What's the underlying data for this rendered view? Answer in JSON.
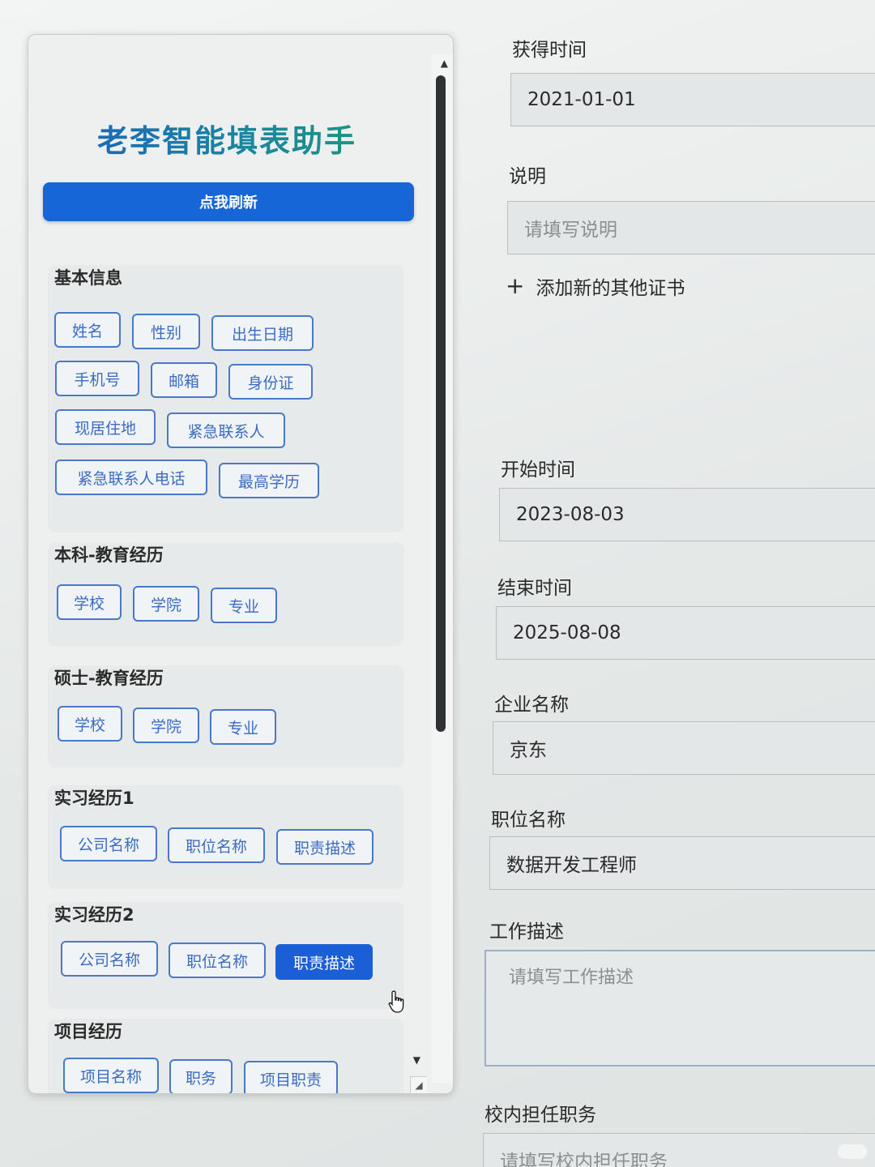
{
  "panel": {
    "title": "老李智能填表助手",
    "refresh_label": "点我刷新",
    "sections": {
      "basic": {
        "title": "基本信息",
        "chips": [
          "姓名",
          "性别",
          "出生日期",
          "手机号",
          "邮箱",
          "身份证",
          "现居住地",
          "紧急联系人",
          "紧急联系人电话",
          "最高学历"
        ]
      },
      "bachelor": {
        "title": "本科-教育经历",
        "chips": [
          "学校",
          "学院",
          "专业"
        ]
      },
      "master": {
        "title": "硕士-教育经历",
        "chips": [
          "学校",
          "学院",
          "专业"
        ]
      },
      "intern1": {
        "title": "实习经历1",
        "chips": [
          "公司名称",
          "职位名称",
          "职责描述"
        ]
      },
      "intern2": {
        "title": "实习经历2",
        "chips": [
          "公司名称",
          "职位名称",
          "职责描述"
        ],
        "active_chip": "职责描述"
      },
      "project": {
        "title": "项目经历",
        "chips": [
          "项目名称",
          "职务",
          "项目职责"
        ]
      }
    }
  },
  "form": {
    "obtain_time": {
      "label": "获得时间",
      "value": "2021-01-01"
    },
    "note": {
      "label": "说明",
      "placeholder": "请填写说明"
    },
    "add_certificate_label": "添加新的其他证书",
    "start_time": {
      "label": "开始时间",
      "value": "2023-08-03"
    },
    "end_time": {
      "label": "结束时间",
      "value": "2025-08-08"
    },
    "company": {
      "label": "企业名称",
      "value": "京东"
    },
    "position": {
      "label": "职位名称",
      "value": "数据开发工程师"
    },
    "work_desc": {
      "label": "工作描述",
      "placeholder": "请填写工作描述"
    },
    "campus_role": {
      "label": "校内担任职务",
      "placeholder": "请填写校内担任职务"
    }
  },
  "colors": {
    "primary": "#1666d8",
    "chip_border": "#4a78c9",
    "chip_text": "#3b6bc4"
  }
}
